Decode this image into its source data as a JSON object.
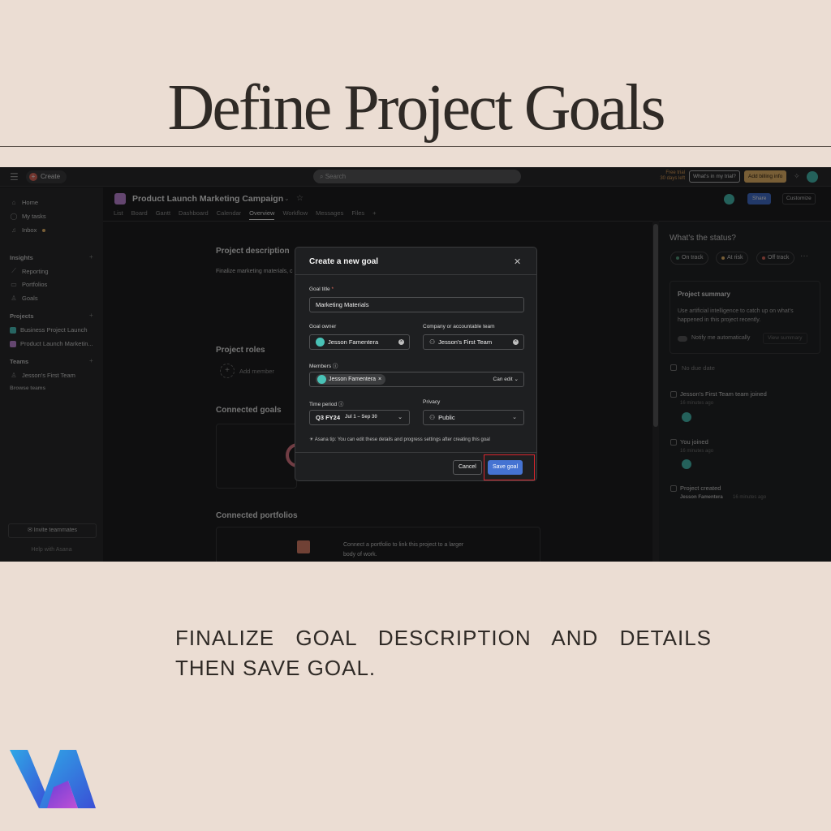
{
  "page": {
    "title": "Define Project Goals",
    "instruction": "FINALIZE GOAL DESCRIPTION AND DETAILS THEN SAVE GOAL."
  },
  "topbar": {
    "create_label": "Create",
    "search_placeholder": "Search",
    "trial_line1": "Free trial",
    "trial_line2": "30 days left",
    "trial_button": "What's in my trial?",
    "billing_button": "Add billing info"
  },
  "sidebar": {
    "home": "Home",
    "my_tasks": "My tasks",
    "inbox": "Inbox",
    "insights_header": "Insights",
    "reporting": "Reporting",
    "portfolios": "Portfolios",
    "goals": "Goals",
    "projects_header": "Projects",
    "projects": [
      {
        "label": "Business Project Launch",
        "color": "#4ecbc4"
      },
      {
        "label": "Product Launch Marketin...",
        "color": "#c98ce0"
      }
    ],
    "teams_header": "Teams",
    "team": "Jesson's First Team",
    "browse_teams": "Browse teams",
    "invite": "Invite teammates",
    "help": "Help with Asana"
  },
  "project": {
    "title": "Product Launch Marketing Campaign",
    "tabs": [
      "List",
      "Board",
      "Gantt",
      "Dashboard",
      "Calendar",
      "Overview",
      "Workflow",
      "Messages",
      "Files"
    ],
    "active_tab": "Overview",
    "share": "Share",
    "customize": "Customize"
  },
  "main": {
    "description_heading": "Project description",
    "description_text": "Finalize marketing materials, c",
    "roles_heading": "Project roles",
    "add_member": "Add member",
    "connected_goals_heading": "Connected goals",
    "connected_portfolios_heading": "Connected portfolios",
    "portfolio_text_1": "Connect a portfolio to link this project to a larger",
    "portfolio_text_2": "body of work."
  },
  "right_panel": {
    "status_question": "What's the status?",
    "on_track": "On track",
    "at_risk": "At risk",
    "off_track": "Off track",
    "summary_title": "Project summary",
    "summary_desc": "Use artificial intelligence to catch up on what's happened in this project recently.",
    "notify": "Notify me automatically",
    "view_summary": "View summary",
    "no_due_date": "No due date",
    "team_joined": "Jesson's First Team team joined",
    "team_joined_time": "16 minutes ago",
    "you_joined": "You joined",
    "you_joined_time": "16 minutes ago",
    "project_created": "Project created",
    "created_by": "Jesson Famentera",
    "created_time": "16 minutes ago"
  },
  "modal": {
    "title": "Create a new goal",
    "goal_title_label": "Goal title",
    "goal_title_value": "Marketing Materials",
    "owner_label": "Goal owner",
    "owner_value": "Jesson Famentera",
    "team_label": "Company or accountable team",
    "team_value": "Jesson's First Team",
    "members_label": "Members",
    "member_chip": "Jesson Famentera",
    "member_permission": "Can edit",
    "time_period_label": "Time period",
    "time_period_value": "Q3 FY24",
    "time_period_range": "Jul 1 – Sep 30",
    "privacy_label": "Privacy",
    "privacy_value": "Public",
    "tip": "Asana tip: You can edit these details and progress settings after creating this goal",
    "cancel": "Cancel",
    "save": "Save goal"
  },
  "colors": {
    "background": "#ebddd3",
    "accent_blue": "#4573d2",
    "highlight_red": "#d8262d",
    "avatar_teal": "#49c2b6"
  }
}
